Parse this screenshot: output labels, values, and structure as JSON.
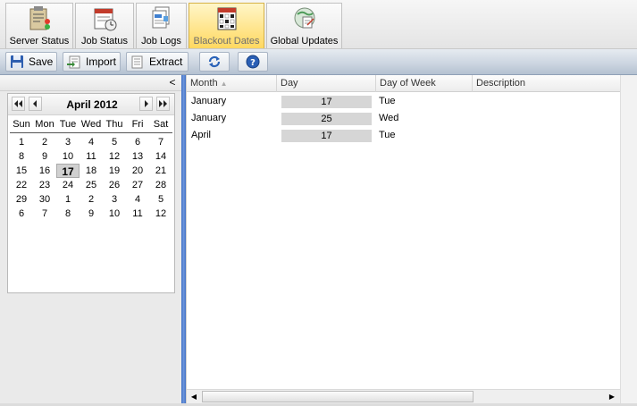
{
  "tabs": [
    {
      "label": "Server Status",
      "icon": "server-status-icon",
      "active": false
    },
    {
      "label": "Job Status",
      "icon": "job-status-icon",
      "active": false
    },
    {
      "label": "Job Logs",
      "icon": "job-logs-icon",
      "active": false
    },
    {
      "label": "Blackout Dates",
      "icon": "calendar-icon",
      "active": true
    },
    {
      "label": "Global Updates",
      "icon": "global-updates-icon",
      "active": false
    }
  ],
  "toolbar": {
    "save_label": "Save",
    "import_label": "Import",
    "extract_label": "Extract",
    "refresh_icon": "refresh-icon",
    "help_icon": "help-icon"
  },
  "sidebar": {
    "collapse_label": "<"
  },
  "calendar": {
    "title": "April 2012",
    "nav": {
      "first": "⏮",
      "prev": "◀",
      "next": "▶",
      "last": "⏭"
    },
    "weekdays": [
      "Sun",
      "Mon",
      "Tue",
      "Wed",
      "Thu",
      "Fri",
      "Sat"
    ],
    "weeks": [
      [
        "1",
        "2",
        "3",
        "4",
        "5",
        "6",
        "7"
      ],
      [
        "8",
        "9",
        "10",
        "11",
        "12",
        "13",
        "14"
      ],
      [
        "15",
        "16",
        "17",
        "18",
        "19",
        "20",
        "21"
      ],
      [
        "22",
        "23",
        "24",
        "25",
        "26",
        "27",
        "28"
      ],
      [
        "29",
        "30",
        "1",
        "2",
        "3",
        "4",
        "5"
      ],
      [
        "6",
        "7",
        "8",
        "9",
        "10",
        "11",
        "12"
      ]
    ],
    "selected_day": "17"
  },
  "grid": {
    "columns": [
      "Month",
      "Day",
      "Day of Week",
      "Description"
    ],
    "sorted_column": "Month",
    "rows": [
      {
        "month": "January",
        "day": "17",
        "dow": "Tue",
        "description": ""
      },
      {
        "month": "January",
        "day": "25",
        "dow": "Wed",
        "description": ""
      },
      {
        "month": "April",
        "day": "17",
        "dow": "Tue",
        "description": ""
      }
    ]
  },
  "colors": {
    "active_tab": "#ffd860",
    "toolbar": "#cdd6e1",
    "splitter": "#3f6fc4"
  }
}
